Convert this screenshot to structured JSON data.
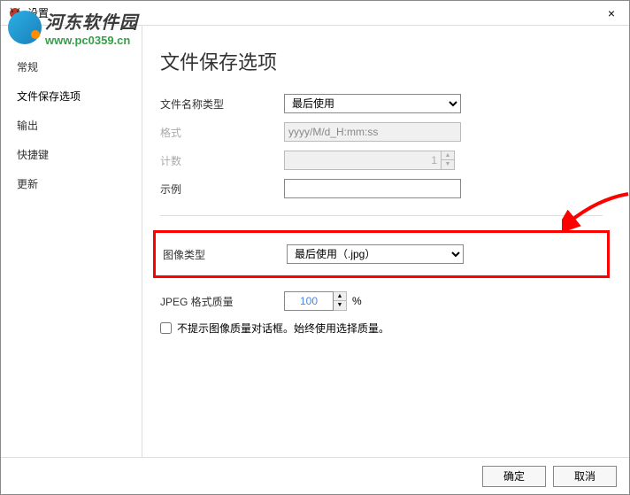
{
  "window": {
    "title": "设置",
    "close": "×"
  },
  "watermark": {
    "cn": "河东软件园",
    "url": "www.pc0359.cn"
  },
  "sidebar": {
    "items": [
      {
        "label": "常规"
      },
      {
        "label": "文件保存选项"
      },
      {
        "label": "输出"
      },
      {
        "label": "快捷键"
      },
      {
        "label": "更新"
      }
    ]
  },
  "page": {
    "title": "文件保存选项",
    "filename_type_label": "文件名称类型",
    "filename_type_value": "最后使用",
    "format_label": "格式",
    "format_value": "yyyy/M/d_H:mm:ss",
    "count_label": "计数",
    "count_value": "1",
    "example_label": "示例",
    "example_value": "",
    "image_type_label": "图像类型",
    "image_type_value": "最后使用（.jpg）",
    "jpeg_quality_label": "JPEG 格式质量",
    "jpeg_quality_value": "100",
    "jpeg_quality_unit": "%",
    "suppress_dialog_label": "不提示图像质量对话框。始终使用选择质量。"
  },
  "footer": {
    "ok": "确定",
    "cancel": "取消"
  }
}
